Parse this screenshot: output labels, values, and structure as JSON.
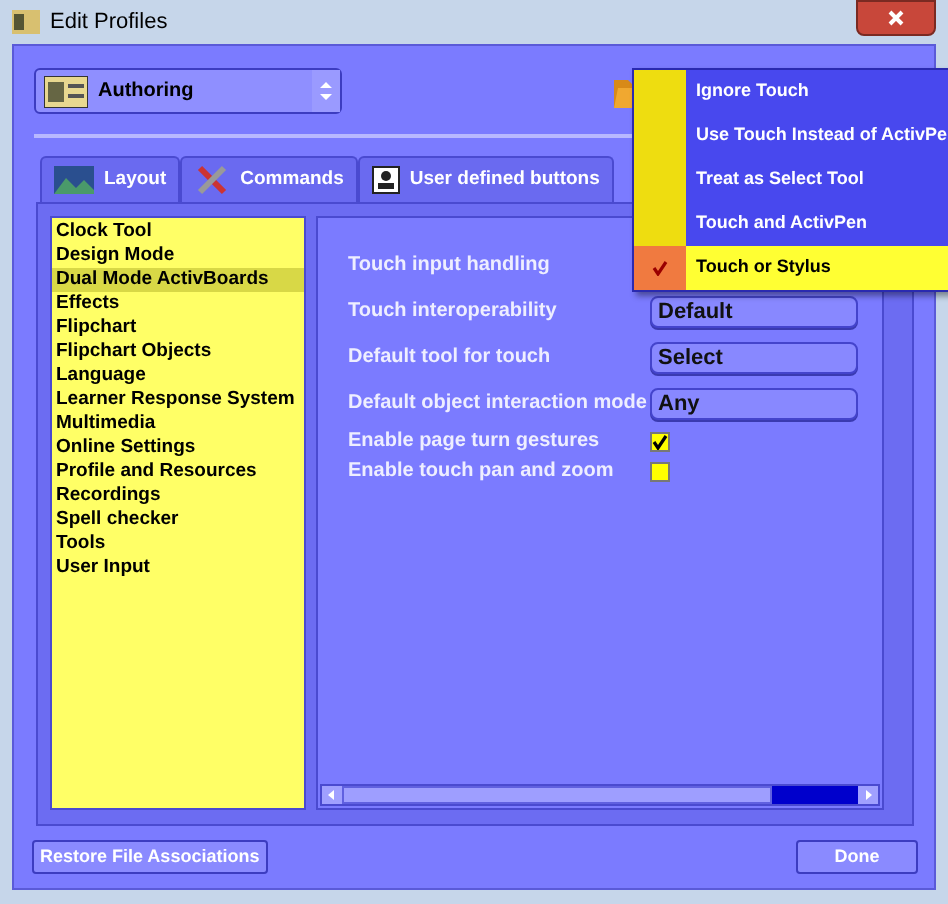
{
  "window": {
    "title": "Edit Profiles"
  },
  "profile": {
    "value": "Authoring"
  },
  "tabs": [
    {
      "label": "Layout",
      "selected": false
    },
    {
      "label": "Commands",
      "selected": false
    },
    {
      "label": "User defined buttons",
      "selected": false
    }
  ],
  "categories": [
    {
      "label": "Clock Tool",
      "selected": false
    },
    {
      "label": "Design Mode",
      "selected": false
    },
    {
      "label": "Dual Mode ActivBoards",
      "selected": true
    },
    {
      "label": "Effects",
      "selected": false
    },
    {
      "label": "Flipchart",
      "selected": false
    },
    {
      "label": "Flipchart Objects",
      "selected": false
    },
    {
      "label": "Language",
      "selected": false
    },
    {
      "label": "Learner Response System",
      "selected": false
    },
    {
      "label": "Multimedia",
      "selected": false
    },
    {
      "label": "Online Settings",
      "selected": false
    },
    {
      "label": "Profile and Resources",
      "selected": false
    },
    {
      "label": "Recordings",
      "selected": false
    },
    {
      "label": "Spell checker",
      "selected": false
    },
    {
      "label": "Tools",
      "selected": false
    },
    {
      "label": "User Input",
      "selected": false
    }
  ],
  "settings": [
    {
      "kind": "covered",
      "label": "Touch input handling"
    },
    {
      "kind": "dropdown",
      "label": "Touch interoperability",
      "value": "Default"
    },
    {
      "kind": "dropdown",
      "label": "Default tool for touch",
      "value": "Select"
    },
    {
      "kind": "dropdown",
      "label": "Default object interaction mode",
      "value": "Any"
    },
    {
      "kind": "checkbox",
      "label": "Enable page turn gestures",
      "checked": true
    },
    {
      "kind": "checkbox",
      "label": "Enable touch pan and zoom",
      "checked": false
    }
  ],
  "menu": [
    {
      "label": "Ignore Touch",
      "selected": false,
      "checked": false
    },
    {
      "label": "Use Touch Instead of ActivPe",
      "selected": false,
      "checked": false
    },
    {
      "label": "Treat as Select Tool",
      "selected": false,
      "checked": false
    },
    {
      "label": "Touch and ActivPen",
      "selected": false,
      "checked": false
    },
    {
      "label": "Touch or Stylus",
      "selected": true,
      "checked": true
    }
  ],
  "buttons": {
    "restore": "Restore File Associations",
    "done": "Done"
  }
}
